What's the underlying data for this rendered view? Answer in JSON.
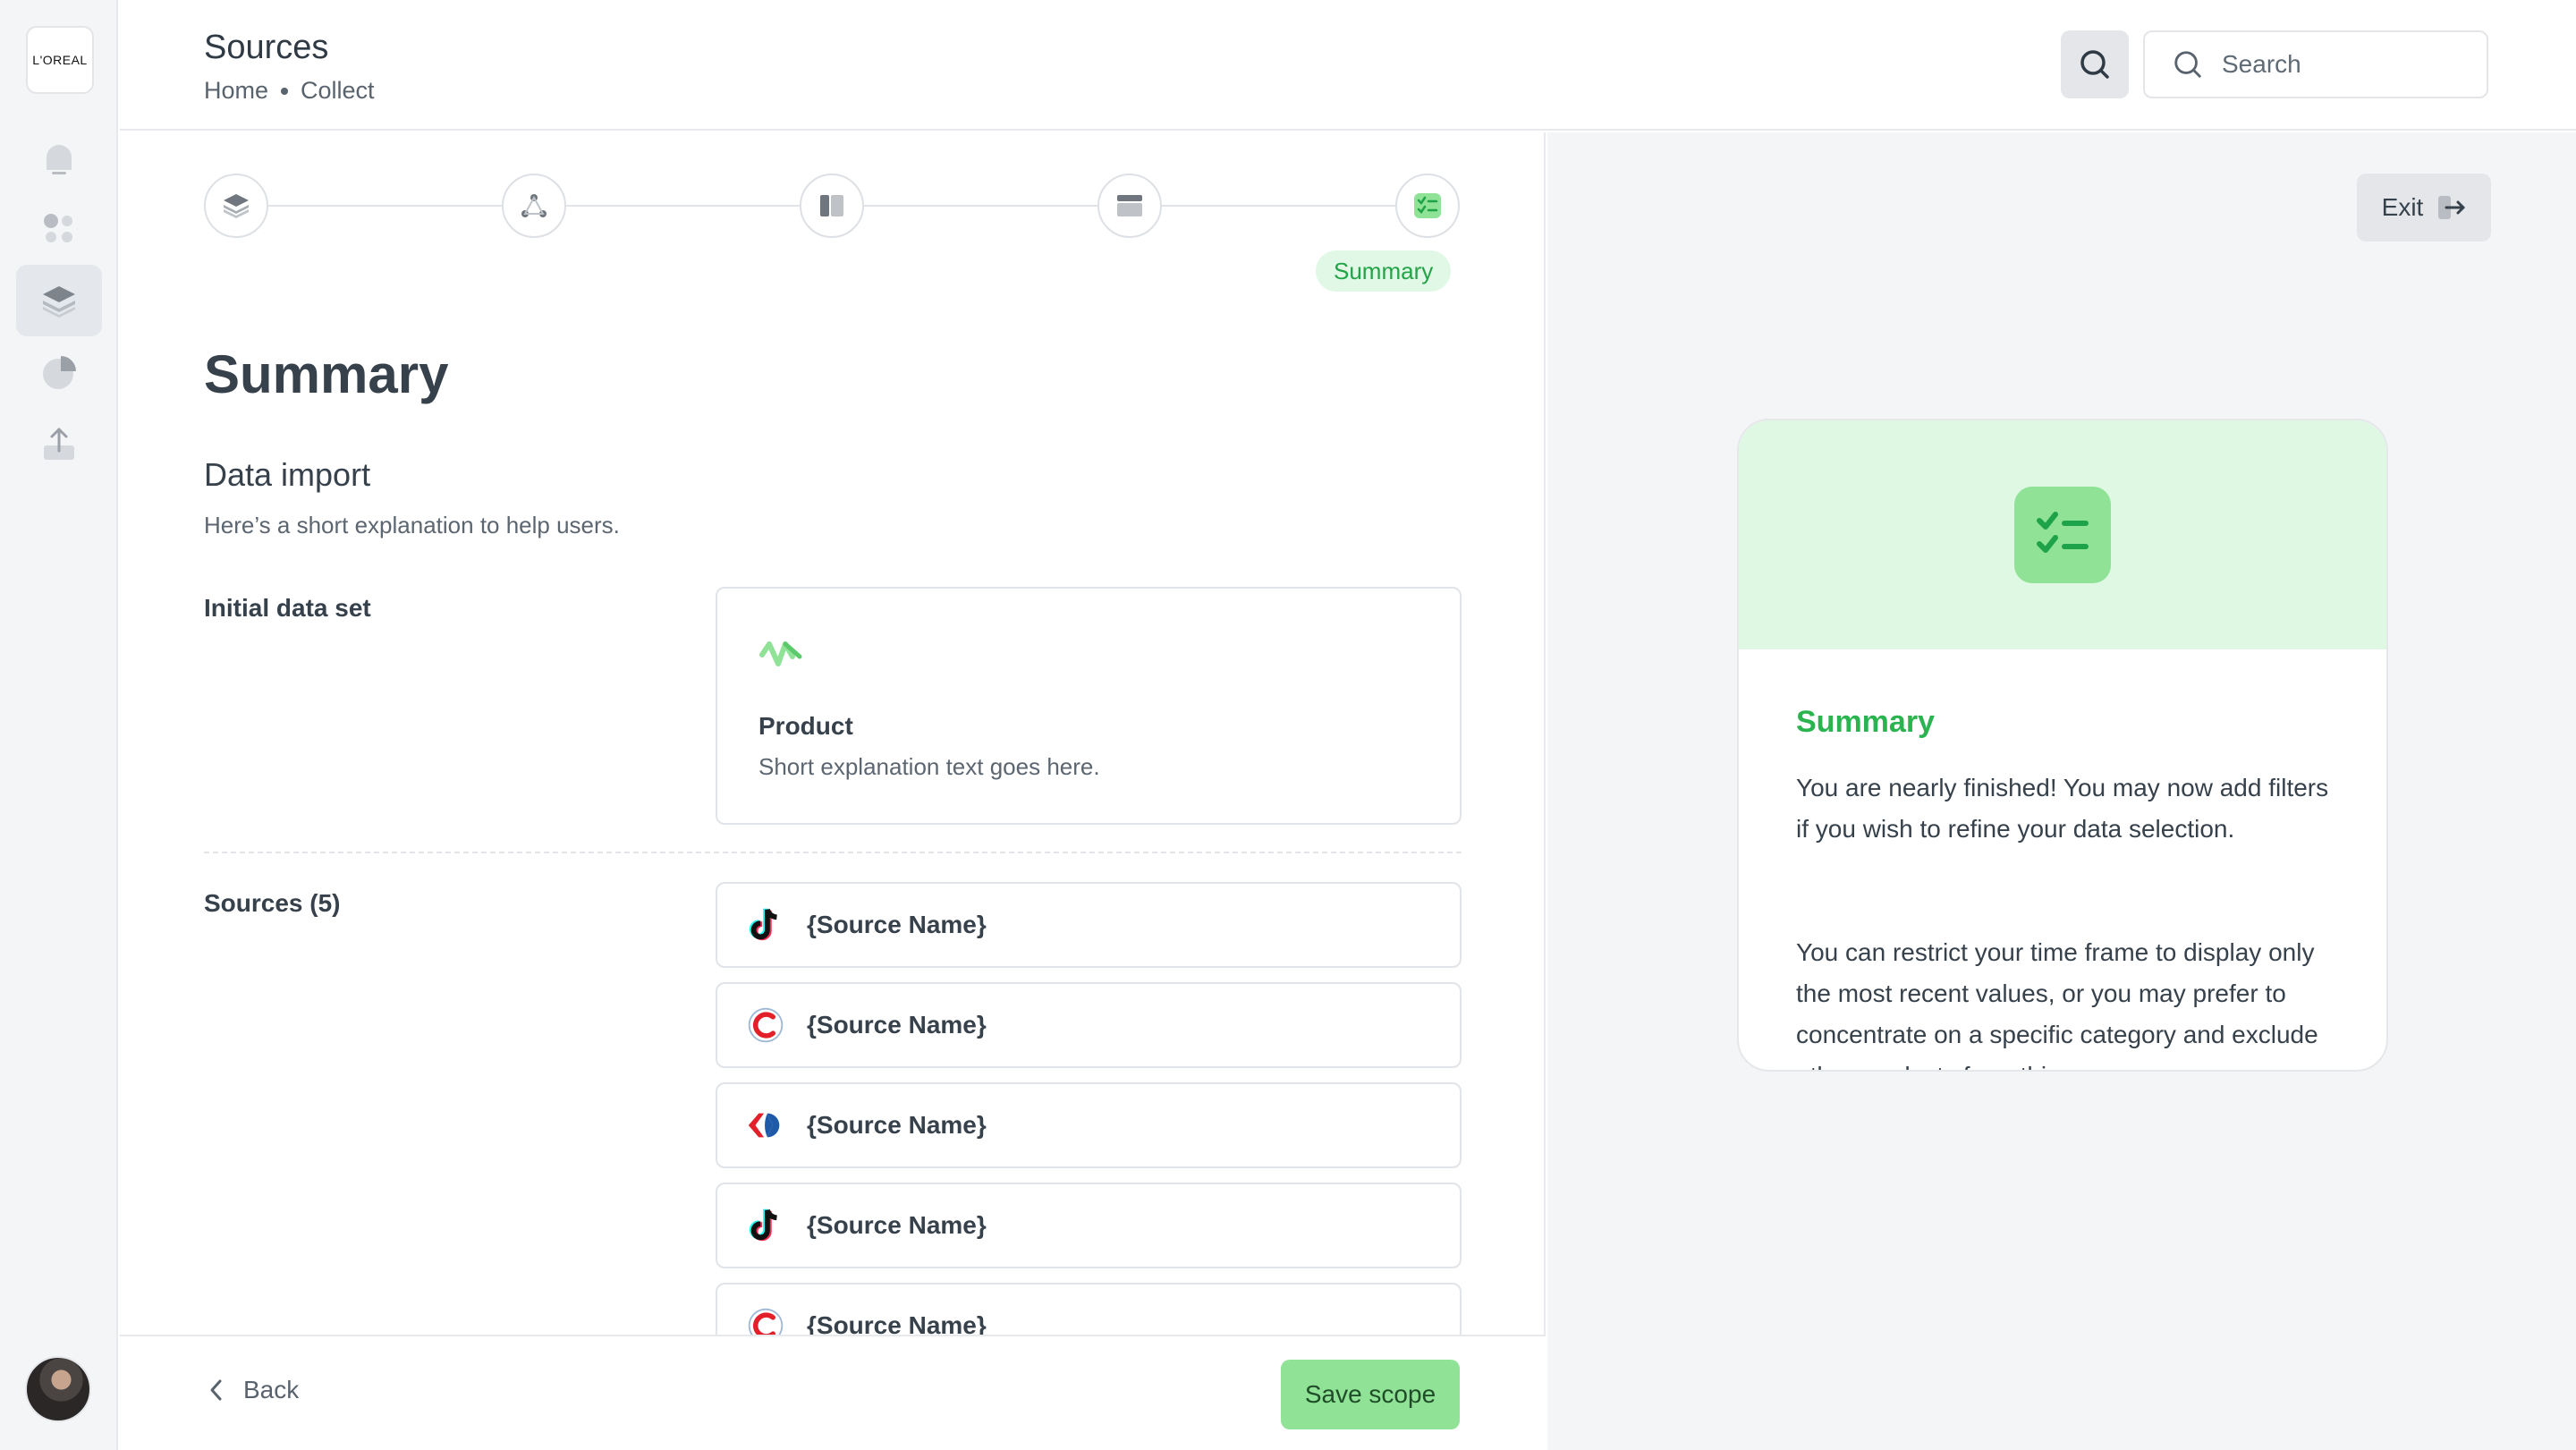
{
  "brand": {
    "logo_text": "L'OREAL",
    "accent": "#8fe296",
    "accent_text": "#2ab34f"
  },
  "sidebar": {
    "items": [
      {
        "name": "home",
        "icon": "home-icon",
        "active": false
      },
      {
        "name": "apps",
        "icon": "grid-dots-icon",
        "active": false
      },
      {
        "name": "sources",
        "icon": "layers-icon",
        "active": true
      },
      {
        "name": "analytics",
        "icon": "pie-chart-icon",
        "active": false
      },
      {
        "name": "export",
        "icon": "upload-icon",
        "active": false
      }
    ]
  },
  "header": {
    "title": "Sources",
    "breadcrumb": [
      "Home",
      "Collect"
    ],
    "search_placeholder": "Search"
  },
  "stepper": {
    "steps": [
      "layers-icon",
      "nodes-icon",
      "layout-icon",
      "table-icon",
      "checklist-icon"
    ],
    "active_label": "Summary"
  },
  "main": {
    "title": "Summary",
    "section_title": "Data import",
    "section_desc": "Here’s a short explanation to help users.",
    "initial_label": "Initial data set",
    "dataset": {
      "title": "Product",
      "desc": "Short explanation text goes here."
    },
    "sources_label": "Sources (5)",
    "sources": [
      {
        "name": "{Source Name}",
        "logo": "tiktok-logo"
      },
      {
        "name": "{Source Name}",
        "logo": "c-logo"
      },
      {
        "name": "{Source Name}",
        "logo": "carrefour-logo"
      },
      {
        "name": "{Source Name}",
        "logo": "tiktok-logo"
      },
      {
        "name": "{Source Name}",
        "logo": "c-logo"
      }
    ]
  },
  "footer": {
    "back_label": "Back",
    "save_label": "Save scope"
  },
  "right": {
    "exit_label": "Exit",
    "card": {
      "title": "Summary",
      "p1": "You are nearly finished! You may now add filters if you wish to refine your data selection.",
      "p2": "You can restrict your time frame to display only the most recent values, or you may prefer to concentrate on a specific category and exclude other products from this scope."
    }
  }
}
